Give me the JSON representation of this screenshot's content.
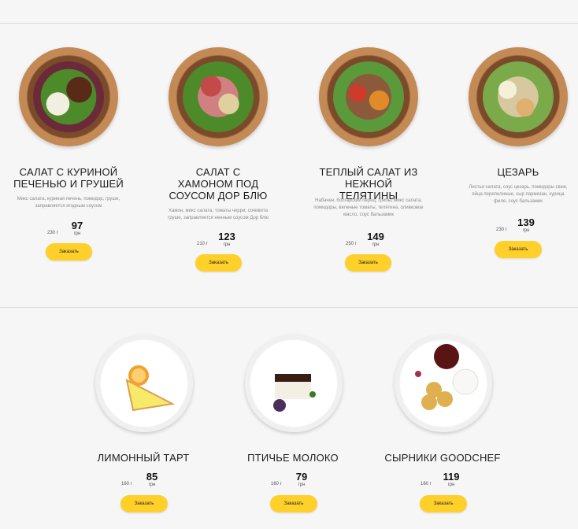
{
  "colors": {
    "accent": "#ffd02a",
    "background": "#f6f6f6",
    "divider": "#d9d9d9"
  },
  "salads": [
    {
      "title": "САЛАТ С КУРИНОЙ ПЕЧЕНЬЮ И ГРУШЕЙ",
      "desc": "Микс салата, куриная печень, помидор, груше, заправляется ягодным соусом",
      "weight": "230 г",
      "price": "97",
      "currency": "грн",
      "button": "Заказать"
    },
    {
      "title": "САЛАТ С ХАМОНОМ ПОД СОУСОМ ДОР БЛЮ",
      "desc": "Хамон, микс салата, томаты черри, сочивита груше, заправляется ненным соусом Дор блю",
      "weight": "210 г",
      "price": "123",
      "currency": "грн",
      "button": "Заказать"
    },
    {
      "title": "ТЕПЛЫЙ САЛАТ ИЗ НЕЖНОЙ ТЕЛЯТИНЫ",
      "desc": "Набачен, болгарский перец, грибы, микс салата, помидоры, вяленые томаты, телятина, оливковое масло, соус бальзамик",
      "weight": "250 г",
      "price": "149",
      "currency": "грн",
      "button": "Заказать"
    },
    {
      "title": "ЦЕЗАРЬ",
      "desc": "Листья салата, соус цезарь, помидоры свеж, яйца перепелиные, сыр пармезан, курица филе, соус бальзамик",
      "weight": "230 г",
      "price": "139",
      "currency": "грн",
      "button": "Заказать"
    }
  ],
  "desserts": [
    {
      "title": "ЛИМОННЫЙ ТАРТ",
      "weight": "160 г",
      "price": "85",
      "currency": "грн",
      "button": "Заказать"
    },
    {
      "title": "ПТИЧЬЕ МОЛОКО",
      "weight": "160 г",
      "price": "79",
      "currency": "грн",
      "button": "Заказать"
    },
    {
      "title": "СЫРНИКИ GOODCHEF",
      "weight": "160 г",
      "price": "119",
      "currency": "грн",
      "button": "Заказать"
    }
  ]
}
